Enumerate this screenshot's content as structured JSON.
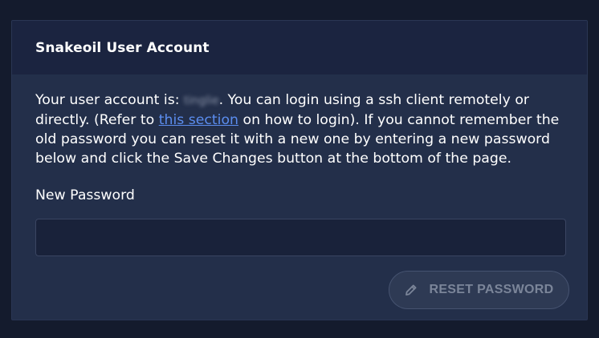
{
  "card": {
    "title": "Snakeoil User Account"
  },
  "description": {
    "prefix": "Your user account is: ",
    "username": "tinglie",
    "middle": ". You can login using a ssh client remotely or directly. (Refer to ",
    "link_text": "this section",
    "suffix": " on how to login). If you cannot remember the old password you can reset it with a new one by entering a new password below and click the Save Changes button at the bottom of the page."
  },
  "new_password": {
    "label": "New Password",
    "value": "",
    "placeholder": ""
  },
  "reset_button": {
    "label": "RESET PASSWORD",
    "icon": "pencil-icon",
    "state": "disabled"
  },
  "colors": {
    "background": "#141b2d",
    "card": "#232f4a",
    "card_header": "#1b2440",
    "link": "#5b8def",
    "button_text_disabled": "#7b8599"
  }
}
